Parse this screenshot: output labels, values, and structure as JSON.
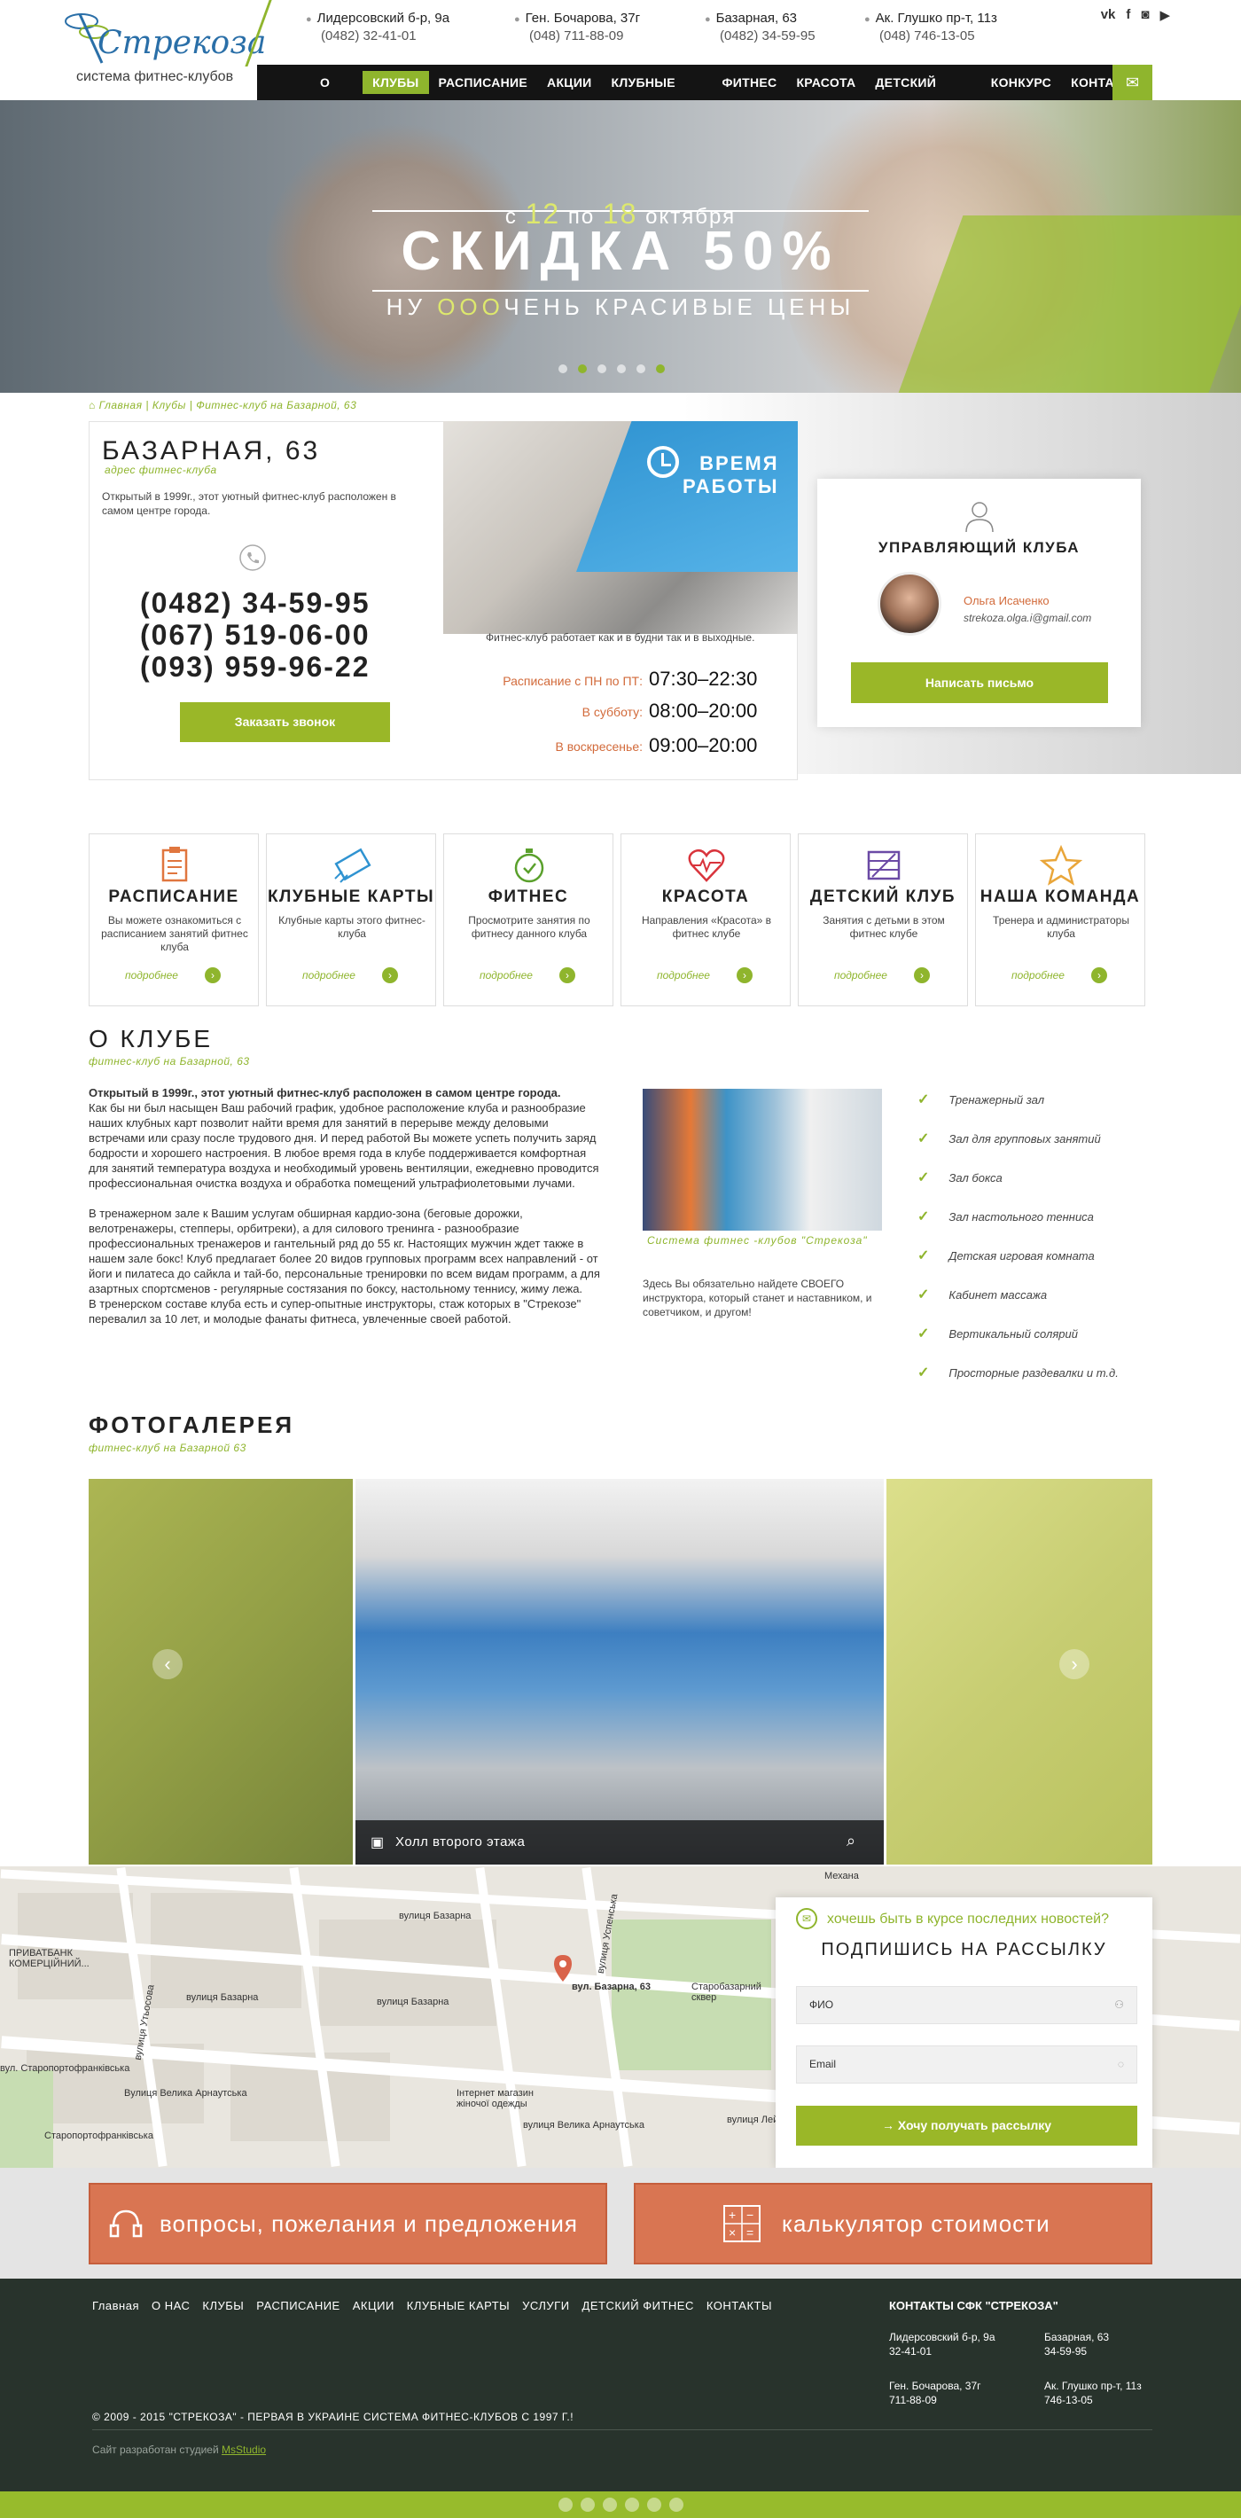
{
  "header": {
    "logo_word": "Стрекоза",
    "logo_sub": "система фитнес-клубов",
    "addresses": [
      {
        "addr": "Лидерсовский б-р, 9а",
        "phone": "(0482) 32-41-01"
      },
      {
        "addr": "Ген. Бочарова, 37г",
        "phone": "(048) 711-88-09"
      },
      {
        "addr": "Базарная, 63",
        "phone": "(0482) 34-59-95"
      },
      {
        "addr": "Ак. Глушко пр-т, 11з",
        "phone": "(048) 746-13-05"
      }
    ],
    "social": [
      "vk-icon",
      "facebook-icon",
      "instagram-icon",
      "youtube-icon"
    ]
  },
  "nav": {
    "items": [
      "О НАС",
      "КЛУБЫ",
      "РАСПИСАНИЕ",
      "АКЦИИ",
      "КЛУБНЫЕ КАРТЫ",
      "ФИТНЕС",
      "КРАСОТА",
      "ДЕТСКИЙ ФИТНЕС",
      "КОНКУРС",
      "КОНТАКТЫ"
    ],
    "active": "КЛУБЫ"
  },
  "hero": {
    "from": "с",
    "d1": "12",
    "mid": "по",
    "d2": "18",
    "month": "октября",
    "main": "СКИДКА 50%",
    "sub_a": "НУ",
    "sub_b": "ООО",
    "sub_c": "ЧЕНЬ КРАСИВЫЕ ЦЕНЫ"
  },
  "breadcrumb": {
    "home": "Главная",
    "sep1": "|",
    "clubs": "Клубы",
    "sep2": "|",
    "current": "Фитнес-клуб на Базарной, 63"
  },
  "club": {
    "title": "БАЗАРНАЯ, 63",
    "subtitle": "адрес фитнес-клуба",
    "desc": "Открытый в 1999г., этот уютный фитнес-клуб расположен в самом центре города.",
    "phones": [
      "(0482) 34-59-95",
      "(067) 519-06-00",
      "(093) 959-96-22"
    ],
    "call_btn": "Заказать звонок"
  },
  "hours": {
    "title_1": "ВРЕМЯ",
    "title_2": "РАБОТЫ",
    "note": "Фитнес-клуб работает как и в будни так и в выходные.",
    "rows": [
      {
        "label": "Расписание с ПН по ПТ:",
        "value": "07:30–22:30"
      },
      {
        "label": "В субботу:",
        "value": "08:00–20:00"
      },
      {
        "label": "В воскресенье:",
        "value": "09:00–20:00"
      }
    ]
  },
  "manager": {
    "title": "УПРАВЛЯЮЩИЙ КЛУБА",
    "name": "Ольга Исаченко",
    "email": "strekoza.olga.i@gmail.com",
    "btn": "Написать письмо"
  },
  "blocks": [
    {
      "icon": "clipboard-icon",
      "title": "РАСПИСАНИЕ",
      "text": "Вы можете ознакомиться с расписанием занятий фитнес клуба",
      "more": "подробнее"
    },
    {
      "icon": "card-icon",
      "title": "КЛУБНЫЕ КАРТЫ",
      "text": "Клубные карты этого фитнес-клуба",
      "more": "подробнее"
    },
    {
      "icon": "stopwatch-icon",
      "title": "ФИТНЕС",
      "text": "Просмотрите занятия по фитнесу данного клуба",
      "more": "подробнее"
    },
    {
      "icon": "heart-pulse-icon",
      "title": "КРАСОТА",
      "text": "Направления «Красота» в фитнес клубе",
      "more": "подробнее"
    },
    {
      "icon": "kids-icon",
      "title": "ДЕТСКИЙ КЛУБ",
      "text": "Занятия с детьми в этом фитнес клубе",
      "more": "подробнее"
    },
    {
      "icon": "star-icon",
      "title": "НАША КОМАНДА",
      "text": "Тренера и администраторы клуба",
      "more": "подробнее"
    }
  ],
  "about": {
    "title": "О КЛУБЕ",
    "subtitle": "фитнес-клуб на Базарной, 63",
    "lead": "Открытый в 1999г., этот уютный фитнес-клуб расположен в самом центре города.",
    "p1": "Как бы ни был насыщен Ваш рабочий график, удобное расположение клуба и разнообразие наших клубных карт позволит найти время для занятий в перерыве между деловыми встречами или сразу после трудового дня. И перед работой Вы можете успеть получить заряд бодрости и хорошего настроения. В любое время года в клубе поддерживается комфортная для занятий температура воздуха и необходимый уровень вентиляции, ежедневно проводится профессиональная очистка воздуха и обработка помещений ультрафиолетовыми лучами.",
    "p2": "В тренажерном зале к Вашим услугам обширная кардио-зона (беговые дорожки, велотренажеры, степперы, орбитреки), а для силового тренинга - разнообразие профессиональных тренажеров и гантельный ряд до 55 кг. Настоящих мужчин ждет также в нашем зале бокс! Клуб предлагает более 20 видов групповых программ всех направлений - от йоги и пилатеса до сайкла и тай-бо, персональные тренировки по всем видам программ, а для азартных спортсменов - регулярные состязания по боксу, настольному теннису, жиму лежа.",
    "p3": "В тренерском составе клуба есть и супер-опытные инструкторы, стаж которых в \"Стрекозе\" перевалил за 10 лет, и молодые фанаты фитнеса, увлеченные своей работой.",
    "caption": "Система фитнес -клубов \"Стрекоза\"",
    "side": "Здесь Вы обязательно найдете СВОЕГО инструктора, который станет и наставником, и советчиком, и другом!",
    "features": [
      "Тренажерный зал",
      "Зал для групповых занятий",
      "Зал бокса",
      "Зал настольного тенниса",
      "Детская игровая комната",
      "Кабинет массажа",
      "Вертикальный солярий",
      "Просторные раздевалки  и т.д."
    ]
  },
  "gallery": {
    "title": "ФОТОГАЛЕРЕЯ",
    "subtitle": "фитнес-клуб на Базарной 63",
    "caption": "Холл второго этажа"
  },
  "map": {
    "labels": [
      "вул. Базарна, 63",
      "вулиця Базарна",
      "вулиця Базарна",
      "вулиця Базарна",
      "Вулиця Велика Арнаутська",
      "вулиця Велика Арнаутська",
      "ПРИВАТБАНК КОМЕРЦІЙНИЙ...",
      "вулиця Утьосова",
      "Старобазарний сквер",
      "Інтернет магазин жіночої одежды",
      "вул. Старопортофранківська",
      "Старопортофранківська",
      "Механа",
      "вулиця Успенська",
      "вулиця Лейтенанта Шмідта"
    ]
  },
  "subscribe": {
    "question": "хочешь быть в курсе последних новостей?",
    "title": "ПОДПИШИСЬ НА РАССЫЛКУ",
    "name_ph": "ФИО",
    "email_ph": "Email",
    "btn": "Хочу получать рассылку"
  },
  "cta": {
    "left": "вопросы, пожелания и предложения",
    "right": "калькулятор стоимости"
  },
  "footer": {
    "nav": [
      "Главная",
      "О НАС",
      "КЛУБЫ",
      "РАСПИСАНИЕ",
      "АКЦИИ",
      "КЛУБНЫЕ КАРТЫ",
      "УСЛУГИ",
      "ДЕТСКИЙ ФИТНЕС",
      "КОНТАКТЫ"
    ],
    "contacts_title": "КОНТАКТЫ  СФК \"СТРЕКОЗА\"",
    "contacts": [
      {
        "addr": "Лидерсовский б-р, 9а",
        "phone": "32-41-01"
      },
      {
        "addr": "Базарная, 63",
        "phone": "34-59-95"
      },
      {
        "addr": "Ген. Бочарова, 37г",
        "phone": "711-88-09"
      },
      {
        "addr": "Ак. Глушко пр-т, 11з",
        "phone": "746-13-05"
      }
    ],
    "copyright": "© 2009 - 2015 \"СТРЕКОЗА\" - ПЕРВАЯ В УКРАИНЕ СИСТЕМА ФИТНЕС-КЛУБОВ С 1997 Г.!",
    "dev_prefix": "Сайт разработан студией",
    "dev_link": "MsStudio",
    "social": [
      "twitter-icon",
      "facebook-icon",
      "google-plus-icon",
      "pinterest-icon",
      "linkedin-icon",
      "instagram-icon"
    ]
  },
  "colors": {
    "green": "#8fb52d",
    "orange": "#d97552",
    "blue": "#2f93d1",
    "dark": "#141414",
    "footer": "#28332c"
  }
}
